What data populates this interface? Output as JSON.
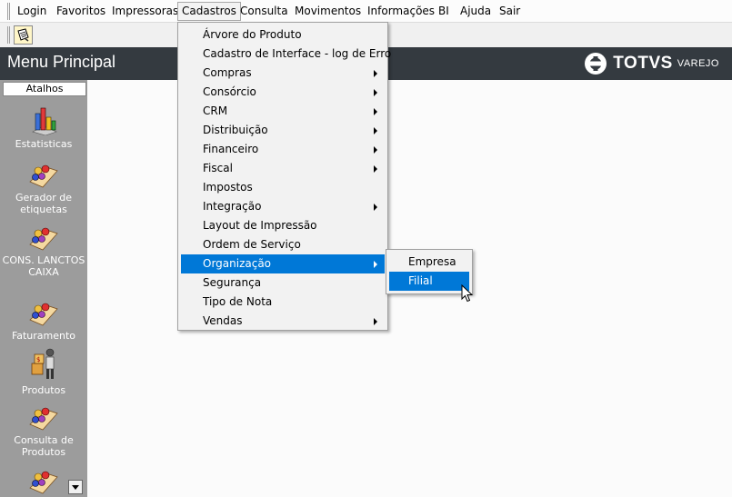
{
  "menubar": {
    "items": [
      {
        "label": "Login"
      },
      {
        "label": "Favoritos"
      },
      {
        "label": "Impressoras"
      },
      {
        "label": "Cadastros"
      },
      {
        "label": "Consulta"
      },
      {
        "label": "Movimentos"
      },
      {
        "label": "Informações"
      },
      {
        "label": "BI"
      },
      {
        "label": "Ajuda"
      },
      {
        "label": "Sair"
      }
    ],
    "open_item": "Cadastros"
  },
  "header": {
    "title": "Menu Principal",
    "logo_brand": "TOTVS",
    "logo_sub": "VAREJO"
  },
  "sidebar": {
    "tab_label": "Atalhos",
    "items": [
      {
        "label": "Estatisticas",
        "icon": "chart-icon"
      },
      {
        "label": "Gerador de etiquetas",
        "icon": "people-icon"
      },
      {
        "label": "CONS. LANCTOS CAIXA",
        "icon": "people-icon"
      },
      {
        "label": "Faturamento",
        "icon": "people-icon"
      },
      {
        "label": "Produtos",
        "icon": "boxes-person-icon"
      },
      {
        "label": "Consulta de Produtos",
        "icon": "people-icon"
      },
      {
        "label": "",
        "icon": "people-icon"
      }
    ]
  },
  "dropdown": {
    "items": [
      {
        "label": "Árvore do Produto",
        "submenu": false
      },
      {
        "label": "Cadastro de Interface - log de Erro",
        "submenu": false
      },
      {
        "label": "Compras",
        "submenu": true
      },
      {
        "label": "Consórcio",
        "submenu": true
      },
      {
        "label": "CRM",
        "submenu": true
      },
      {
        "label": "Distribuição",
        "submenu": true
      },
      {
        "label": "Financeiro",
        "submenu": true
      },
      {
        "label": "Fiscal",
        "submenu": true
      },
      {
        "label": "Impostos",
        "submenu": false
      },
      {
        "label": "Integração",
        "submenu": true
      },
      {
        "label": "Layout de Impressão",
        "submenu": false
      },
      {
        "label": "Ordem de Serviço",
        "submenu": false
      },
      {
        "label": "Organização",
        "submenu": true,
        "selected": true
      },
      {
        "label": "Segurança",
        "submenu": false
      },
      {
        "label": "Tipo de Nota",
        "submenu": false
      },
      {
        "label": "Vendas",
        "submenu": true
      }
    ]
  },
  "submenu": {
    "items": [
      {
        "label": "Empresa"
      },
      {
        "label": "Filial",
        "selected": true
      }
    ]
  },
  "colors": {
    "highlight": "#0078d7",
    "header_bg": "#343a40",
    "sidebar_bg": "#9c9c9c"
  }
}
